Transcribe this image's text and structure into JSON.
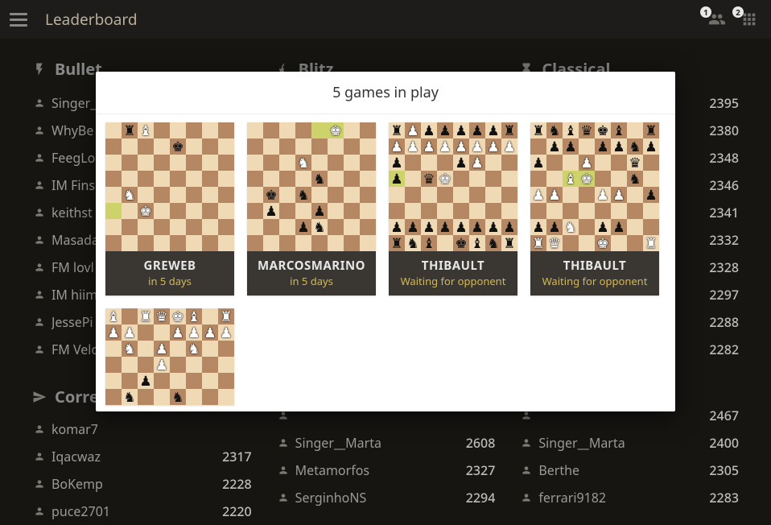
{
  "header": {
    "title": "Leaderboard",
    "right_icons": [
      {
        "name": "friends-icon",
        "badge": "1"
      },
      {
        "name": "challenge-icon",
        "badge": "2"
      }
    ]
  },
  "modal": {
    "title": "5 games in play",
    "games": [
      {
        "player": "GREWEB",
        "subtitle": "in 5 days"
      },
      {
        "player": "MARCOSMARINO",
        "subtitle": "in 5 days"
      },
      {
        "player": "THIBAULT",
        "subtitle": "Waiting for opponent"
      },
      {
        "player": "THIBAULT",
        "subtitle": "Waiting for opponent"
      },
      {
        "player": "",
        "subtitle": ""
      }
    ]
  },
  "columns": {
    "bullet": {
      "label": "Bullet",
      "rows": [
        {
          "name": "Singer__",
          "rating": ""
        },
        {
          "name": "WhyBe",
          "rating": ""
        },
        {
          "name": "FeegLo",
          "rating": ""
        },
        {
          "name": "IM Fins",
          "rating": ""
        },
        {
          "name": "keithst",
          "rating": ""
        },
        {
          "name": "Masada",
          "rating": ""
        },
        {
          "name": "FM lovl",
          "rating": ""
        },
        {
          "name": "IM hiim",
          "rating": ""
        },
        {
          "name": "JessePi",
          "rating": ""
        },
        {
          "name": "FM Velo",
          "rating": ""
        }
      ]
    },
    "blitz": {
      "label": "Blitz",
      "rows": []
    },
    "classical": {
      "label": "Classical",
      "rows": [
        {
          "name": "",
          "rating": "2395"
        },
        {
          "name": "",
          "rating": "2380"
        },
        {
          "name": "",
          "rating": "2348"
        },
        {
          "name": "",
          "rating": "2346"
        },
        {
          "name": "",
          "rating": "2341"
        },
        {
          "name": "",
          "rating": "2332"
        },
        {
          "name": "",
          "rating": "2328"
        },
        {
          "name": "",
          "rating": "2297"
        },
        {
          "name": "",
          "rating": "2288"
        },
        {
          "name": "",
          "rating": "2282"
        }
      ]
    }
  },
  "correspondence": {
    "label": "Corre",
    "cols": [
      {
        "rows": [
          {
            "name": "komar7",
            "rating": ""
          },
          {
            "name": "Iqacwaz",
            "rating": "2317"
          },
          {
            "name": "BoKemp",
            "rating": "2228"
          },
          {
            "name": "puce2701",
            "rating": "2220"
          }
        ]
      },
      {
        "rows": [
          {
            "name": "",
            "rating": ""
          },
          {
            "name": "Singer__Marta",
            "rating": "2608"
          },
          {
            "name": "Metamorfos",
            "rating": "2327"
          },
          {
            "name": "SerginhoNS",
            "rating": "2294"
          }
        ]
      },
      {
        "rows": [
          {
            "name": "",
            "rating": "2467"
          },
          {
            "name": "Singer__Marta",
            "rating": "2400"
          },
          {
            "name": "Berthe",
            "rating": "2305"
          },
          {
            "name": "ferrari9182",
            "rating": "2283"
          }
        ]
      }
    ]
  },
  "boards": [
    {
      "hl": [
        40
      ],
      "pieces": {
        "1": "br",
        "2": "wb",
        "12": "bk",
        "33": "wn",
        "42": "wk"
      }
    },
    {
      "hl": [
        4,
        5
      ],
      "pieces": {
        "5": "wk",
        "19": "wn",
        "28": "bn",
        "33": "bk",
        "35": "bn",
        "41": "bp",
        "44": "bp",
        "51": "bp",
        "52": "bn"
      }
    },
    {
      "hl": [
        24
      ],
      "pieces": {
        "0": "br",
        "1": "wp",
        "2": "bp",
        "3": "bp",
        "4": "bp",
        "5": "bp",
        "6": "bp",
        "7": "br",
        "8": "wp",
        "9": "wp",
        "10": "wp",
        "11": "wp",
        "12": "wp",
        "13": "wp",
        "14": "wp",
        "15": "wp",
        "16": "bp",
        "20": "bp",
        "21": "wp",
        "24": "bp",
        "26": "bq",
        "27": "wk",
        "48": "bp",
        "49": "bp",
        "50": "bp",
        "51": "bp",
        "52": "bp",
        "53": "bp",
        "54": "bp",
        "55": "bp",
        "56": "br",
        "57": "bn",
        "58": "bb",
        "60": "bk",
        "61": "bb",
        "62": "bn",
        "63": "br"
      }
    },
    {
      "hl": [
        26,
        27
      ],
      "pieces": {
        "0": "br",
        "1": "bn",
        "2": "bb",
        "3": "bq",
        "4": "bk",
        "5": "bb",
        "7": "br",
        "9": "bp",
        "10": "bp",
        "12": "bp",
        "13": "bp",
        "14": "bn",
        "15": "bp",
        "16": "bp",
        "19": "wp",
        "22": "bq",
        "26": "wb",
        "27": "wk",
        "30": "bn",
        "32": "wp",
        "33": "wp",
        "36": "wp",
        "37": "wp",
        "39": "bp",
        "48": "bp",
        "49": "bp",
        "50": "wn",
        "52": "bp",
        "53": "bp",
        "56": "wr",
        "57": "wq",
        "60": "wk",
        "63": "wr"
      }
    },
    {
      "hl": [],
      "pieces": {
        "0": "wb",
        "2": "wr",
        "3": "wq",
        "4": "wk",
        "5": "wb",
        "7": "wr",
        "8": "wp",
        "9": "wp",
        "12": "wp",
        "13": "wp",
        "14": "wp",
        "15": "wp",
        "17": "wn",
        "19": "wp",
        "21": "wn",
        "27": "wp",
        "34": "bp",
        "41": "bn",
        "44": "bn"
      }
    }
  ]
}
